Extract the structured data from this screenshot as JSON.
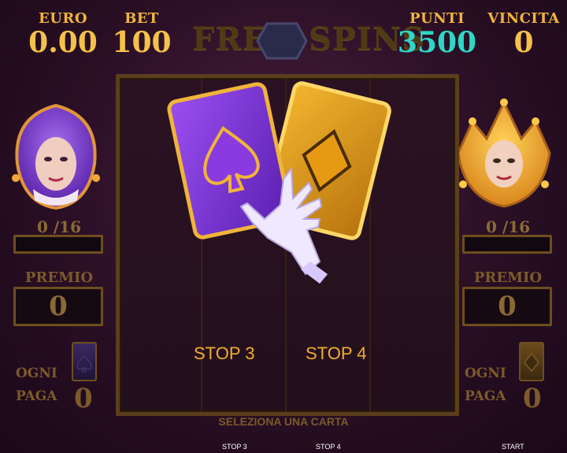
{
  "header": {
    "euro_label": "EURO",
    "euro_value": "0.00",
    "bet_label": "BET",
    "bet_value": "100",
    "punti_label": "PUNTI",
    "punti_value": "3500",
    "vincita_label": "VINCITA",
    "vincita_value": "0",
    "title_left": "FREE",
    "title_right": "SPINS"
  },
  "left_panel": {
    "progress": "0 /16",
    "premio_label": "PREMIO",
    "premio_value": "0",
    "ogni_label": "OGNI",
    "paga_label": "PAGA",
    "paga_value": "0",
    "card_suit": "spade-icon"
  },
  "right_panel": {
    "progress": "0 /16",
    "premio_label": "PREMIO",
    "premio_value": "0",
    "ogni_label": "OGNI",
    "paga_label": "PAGA",
    "paga_value": "0",
    "card_suit": "diamond-icon"
  },
  "reels": {
    "stop3_label": "STOP 3",
    "stop4_label": "STOP 4",
    "cards": [
      {
        "color": "purple",
        "suit": "spade-icon"
      },
      {
        "color": "gold",
        "suit": "diamond-icon"
      }
    ]
  },
  "instruction": "SELEZIONA UNA CARTA",
  "footer": {
    "stop3": "STOP 3",
    "stop4": "STOP 4",
    "start": "START"
  },
  "colors": {
    "gold": "#f6c14a",
    "cyan": "#2fd6c6",
    "purple": "#7b2fd6",
    "frame": "#5b3f1c"
  }
}
